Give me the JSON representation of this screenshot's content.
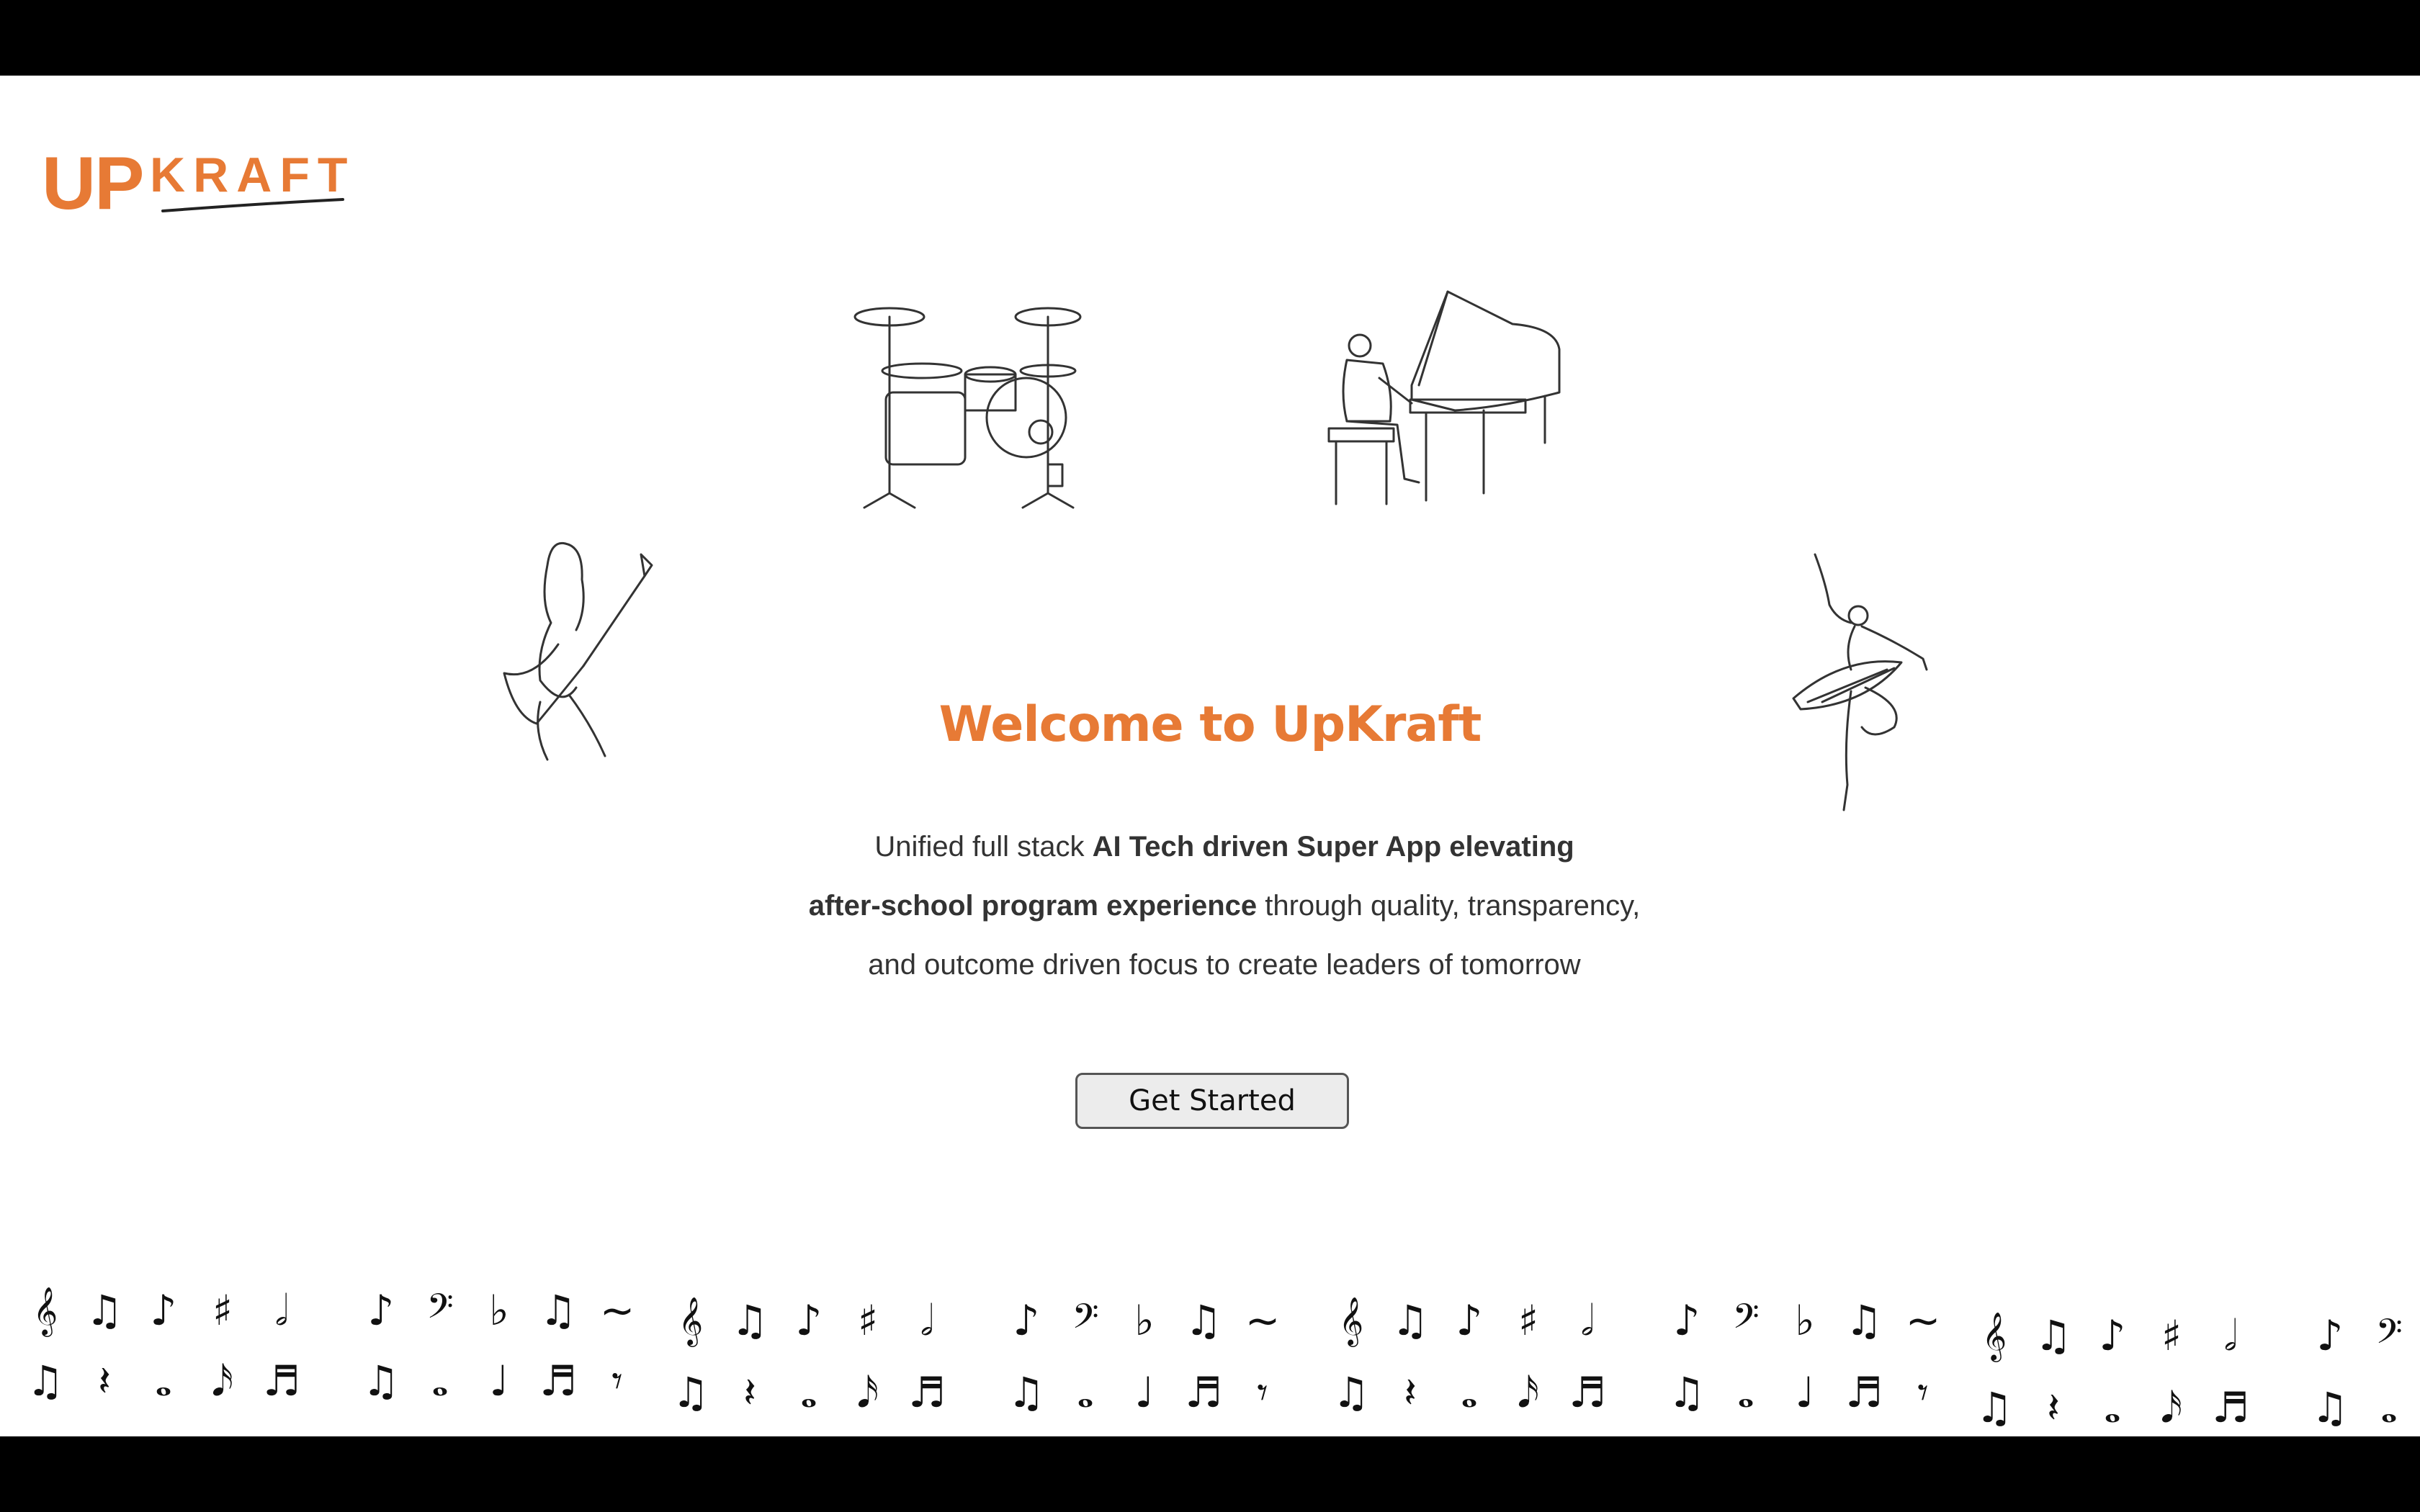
{
  "brand": {
    "logo_up": "UP",
    "logo_kraft": "KRAFT",
    "accent": "#E77A35"
  },
  "illustrations": [
    "drum-kit",
    "grand-piano-with-pianist",
    "electric-guitarist",
    "ballerina"
  ],
  "hero": {
    "title": "Welcome to UpKraft",
    "line1_a": "Unified full stack ",
    "line1_b": "AI Tech driven Super App elevating",
    "line2_a": "after-school program experience",
    "line2_b": " through quality, transparency,",
    "line3": "and outcome driven focus to create leaders of tomorrow"
  },
  "cta": {
    "label": "Get Started"
  },
  "notes": {
    "top": [
      "𝄞",
      "♫",
      "♪",
      "♯",
      "𝅗𝅥",
      "",
      "♪",
      "𝄢",
      "♭",
      "♫",
      "∼"
    ],
    "bottom": [
      "♫",
      "𝄽",
      "𝅝",
      "𝅘𝅥𝅯",
      "♬",
      "",
      "♫",
      "𝅝",
      "♩",
      "♬",
      "𝄾"
    ]
  }
}
